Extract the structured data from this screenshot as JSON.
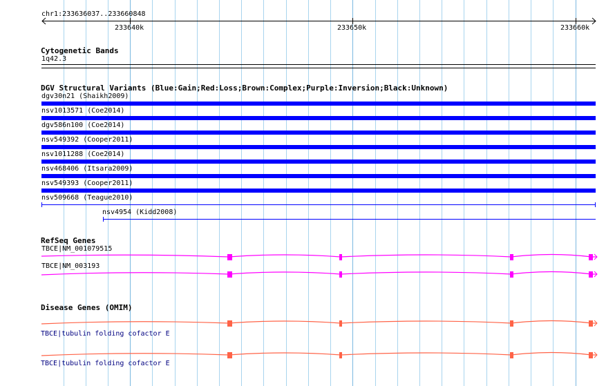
{
  "ruler": {
    "range_label": "chr1:233636037..233660848",
    "ticks": [
      "233640k",
      "233650k",
      "233660k"
    ]
  },
  "cytoband": {
    "title": "Cytogenetic Bands",
    "band": "1q42.3"
  },
  "dgv": {
    "title": "DGV Structural Variants (Blue:Gain;Red:Loss;Brown:Complex;Purple:Inversion;Black:Unknown)",
    "items": [
      {
        "label": "dgv30n21 (Shaikh2009)",
        "type": "Gain",
        "color": "#0000ff"
      },
      {
        "label": "nsv1013571 (Coe2014)",
        "type": "Gain",
        "color": "#0000ff"
      },
      {
        "label": "dgv586n100 (Coe2014)",
        "type": "Gain",
        "color": "#0000ff"
      },
      {
        "label": "nsv549392 (Cooper2011)",
        "type": "Gain",
        "color": "#0000ff"
      },
      {
        "label": "nsv1011288 (Coe2014)",
        "type": "Gain",
        "color": "#0000ff"
      },
      {
        "label": "nsv468406 (Itsara2009)",
        "type": "Gain",
        "color": "#0000ff"
      },
      {
        "label": "nsv549393 (Cooper2011)",
        "type": "Gain",
        "color": "#0000ff"
      },
      {
        "label": "nsv509668 (Teague2010)",
        "type": "Gain",
        "color": "#0000ff"
      },
      {
        "label": "nsv4954 (Kidd2008)",
        "type": "Gain",
        "color": "#0000ff"
      }
    ]
  },
  "refseq": {
    "title": "RefSeq Genes",
    "color": "#ff00ff",
    "items": [
      {
        "label": "TBCE|NM_001079515"
      },
      {
        "label": "TBCE|NM_003193"
      }
    ]
  },
  "omim": {
    "title": "Disease Genes (OMIM)",
    "color": "#ff6347",
    "label_color": "#000080",
    "items": [
      {
        "label": "TBCE|tubulin folding cofactor E"
      },
      {
        "label": "TBCE|tubulin folding cofactor E"
      }
    ]
  }
}
